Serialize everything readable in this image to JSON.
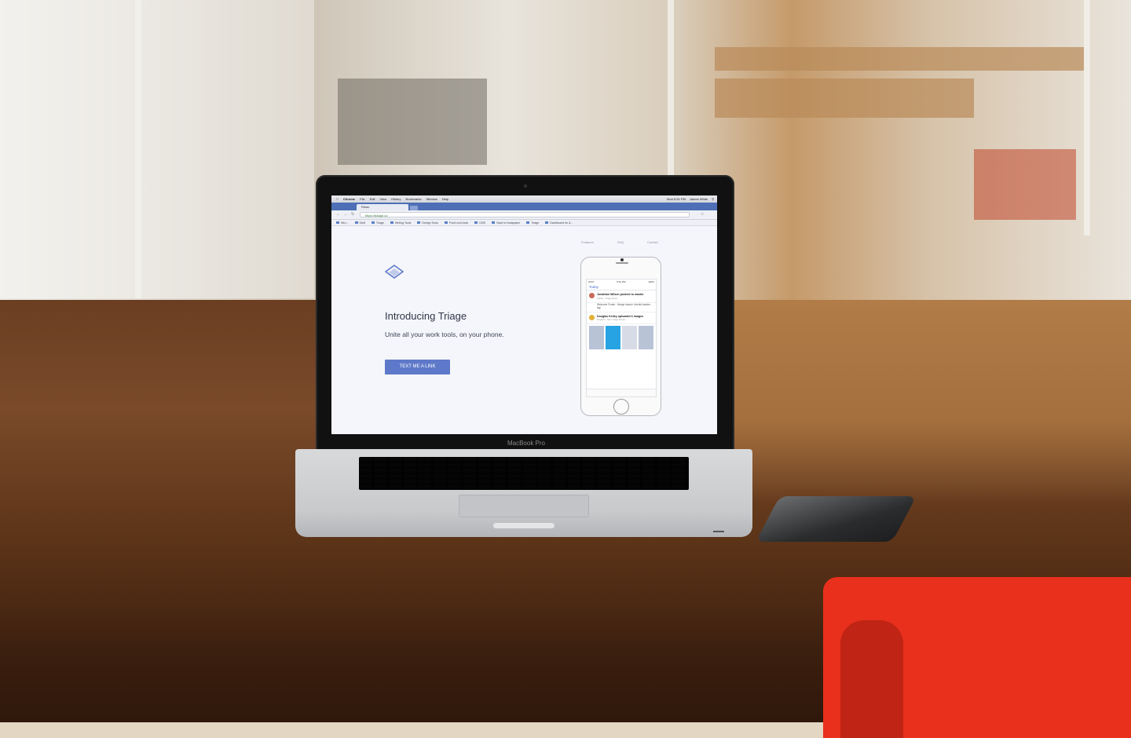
{
  "laptop": {
    "brand_label": "MacBook Pro"
  },
  "mac_menubar": {
    "items": [
      "Chrome",
      "File",
      "Edit",
      "View",
      "History",
      "Bookmarks",
      "Window",
      "Help"
    ],
    "status": [
      "Mon 5:51 PM",
      "James White"
    ]
  },
  "browser": {
    "tab_title": "Relax",
    "url": "https://badge.co",
    "bookmarks": [
      "Wro...",
      "Stuff",
      "Triage",
      "Writing Tools",
      "Design Tools",
      "Front-end tools",
      "CMS",
      "Save to Instapaper",
      "Triage",
      "Dashboard for &..."
    ]
  },
  "site": {
    "nav": [
      "Features",
      "FAQ",
      "Contact"
    ],
    "headline": "Introducing Triage",
    "subline": "Unite all your work tools, on your phone.",
    "cta_label": "TEXT ME A LINK",
    "accent": "#5e79c9"
  },
  "phone_mockup": {
    "status_left": "AT&T",
    "status_center": "5:51 PM",
    "status_right": "100%",
    "header": "Today",
    "item1_title": "Jonathan Wilson pushed to master",
    "item1_meta": "Github · Triage Repo",
    "item1_snippet": "Welcome Footer · Merge branch 'rebuild-header-tag'",
    "item2_title": "Douglas Kelley uploaded 6 images",
    "item2_meta": "Dropbox · New Triage Mocks"
  }
}
